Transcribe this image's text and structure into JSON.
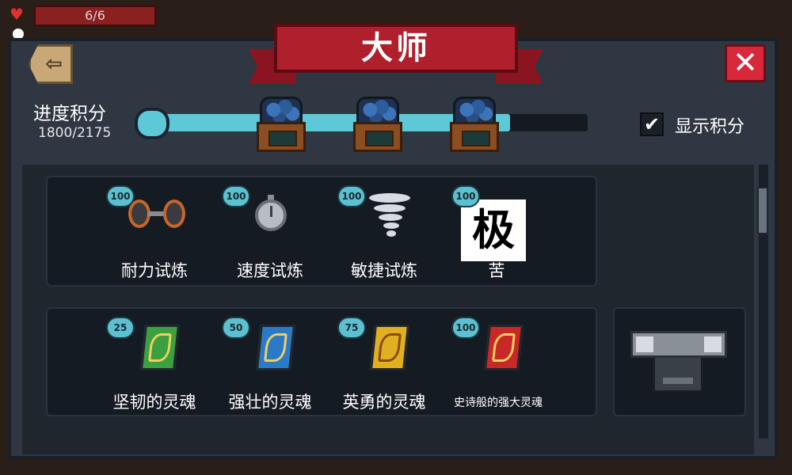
{
  "hud": {
    "hp_text": "6/6"
  },
  "dialog": {
    "title": "大师",
    "back_icon": "back-arrow-icon",
    "close_icon": "close-icon",
    "progress": {
      "label": "进度积分",
      "value_text": "1800/2175",
      "current": 1800,
      "max": 2175,
      "milestone_icon": "gem-chest-icon"
    },
    "show_score": {
      "label": "显示积分",
      "checked": true
    }
  },
  "rows": [
    {
      "items": [
        {
          "badge": "100",
          "label": "耐力试炼",
          "icon": "dumbbell-icon"
        },
        {
          "badge": "100",
          "label": "速度试炼",
          "icon": "stopwatch-icon"
        },
        {
          "badge": "100",
          "label": "敏捷试炼",
          "icon": "tornado-icon"
        },
        {
          "badge": "100",
          "label": "苦",
          "icon": "kanji-image",
          "image_text": "极"
        }
      ]
    },
    {
      "items": [
        {
          "badge": "25",
          "label": "坚韧的灵魂",
          "icon": "green-soul-card-icon",
          "color": "#3aa040"
        },
        {
          "badge": "50",
          "label": "强壮的灵魂",
          "icon": "blue-soul-card-icon",
          "color": "#2a7ac8"
        },
        {
          "badge": "75",
          "label": "英勇的灵魂",
          "icon": "gold-soul-card-icon",
          "color": "#e0b020"
        },
        {
          "badge": "100",
          "label": "史诗般的强大灵魂",
          "icon": "red-soul-card-icon",
          "color": "#c82828"
        }
      ],
      "reward_icon": "silver-chest-icon"
    }
  ],
  "colors": {
    "progress_fill": "#5cc8d8",
    "ribbon": "#b01f2c",
    "close": "#d8283a"
  }
}
